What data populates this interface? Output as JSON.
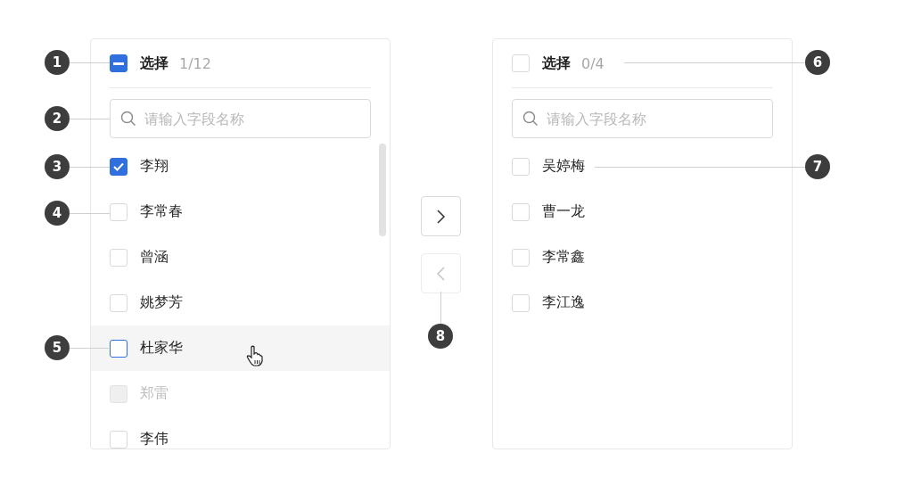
{
  "panels": [
    {
      "header": {
        "title": "选择",
        "count": "1/12",
        "indeterminate": true
      },
      "search": {
        "placeholder": "请输入字段名称"
      },
      "items": [
        {
          "name": "李翔",
          "checked": true,
          "hovered": false,
          "disabled": false
        },
        {
          "name": "李常春",
          "checked": false,
          "hovered": false,
          "disabled": false
        },
        {
          "name": "曾涵",
          "checked": false,
          "hovered": false,
          "disabled": false
        },
        {
          "name": "姚梦芳",
          "checked": false,
          "hovered": false,
          "disabled": false
        },
        {
          "name": "杜家华",
          "checked": false,
          "hovered": true,
          "disabled": false
        },
        {
          "name": "郑雷",
          "checked": false,
          "hovered": false,
          "disabled": true
        },
        {
          "name": "李伟",
          "checked": false,
          "hovered": false,
          "disabled": false
        }
      ]
    },
    {
      "header": {
        "title": "选择",
        "count": "0/4",
        "indeterminate": false
      },
      "search": {
        "placeholder": "请输入字段名称"
      },
      "items": [
        {
          "name": "吴婷梅",
          "checked": false,
          "hovered": false,
          "disabled": false
        },
        {
          "name": "曹一龙",
          "checked": false,
          "hovered": false,
          "disabled": false
        },
        {
          "name": "李常鑫",
          "checked": false,
          "hovered": false,
          "disabled": false
        },
        {
          "name": "李江逸",
          "checked": false,
          "hovered": false,
          "disabled": false
        }
      ]
    }
  ],
  "transfer_buttons": [
    {
      "kind": "right",
      "disabled": false
    },
    {
      "kind": "left",
      "disabled": true
    }
  ],
  "callouts": [
    {
      "label": "1"
    },
    {
      "label": "2"
    },
    {
      "label": "3"
    },
    {
      "label": "4"
    },
    {
      "label": "5"
    },
    {
      "label": "6"
    },
    {
      "label": "7"
    },
    {
      "label": "8"
    }
  ]
}
